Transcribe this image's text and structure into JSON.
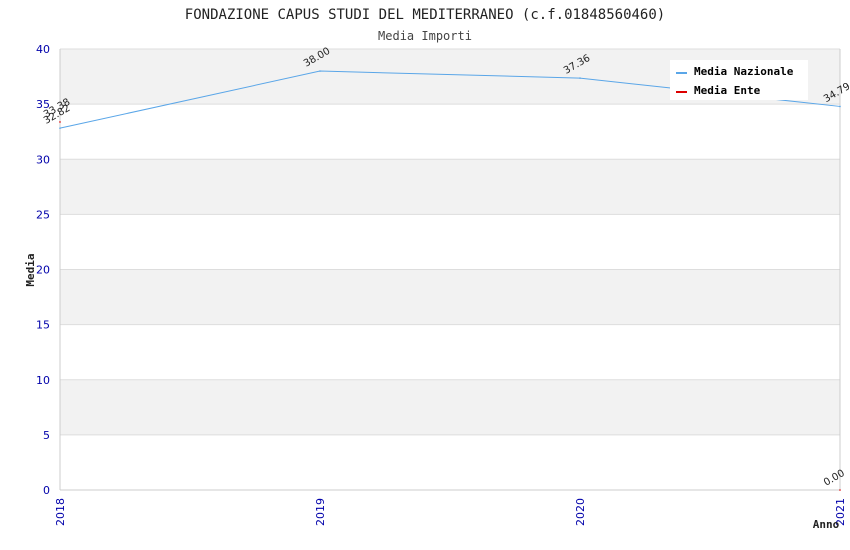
{
  "chart_data": {
    "type": "line",
    "title": "FONDAZIONE CAPUS STUDI DEL MEDITERRANEO (c.f.01848560460)",
    "subtitle": "Media Importi",
    "xlabel": "Anno",
    "ylabel": "Media",
    "categories": [
      "2018",
      "2019",
      "2020",
      "2021"
    ],
    "ylim": [
      0,
      40
    ],
    "yticks": [
      "0",
      "5",
      "10",
      "15",
      "20",
      "25",
      "30",
      "35",
      "40"
    ],
    "grid": true,
    "legend_position": "top-right",
    "series": [
      {
        "name": "Media Nazionale",
        "color": "#5aa6e8",
        "values": [
          32.82,
          38.0,
          37.36,
          34.79
        ],
        "labels": [
          "32.82",
          "38.00",
          "37.36",
          "34.79"
        ]
      },
      {
        "name": "Media Ente",
        "color": "#dd0000",
        "values": [
          33.38,
          null,
          null,
          0.0
        ],
        "labels": [
          "33.38",
          "",
          "",
          "0.00"
        ]
      }
    ]
  }
}
